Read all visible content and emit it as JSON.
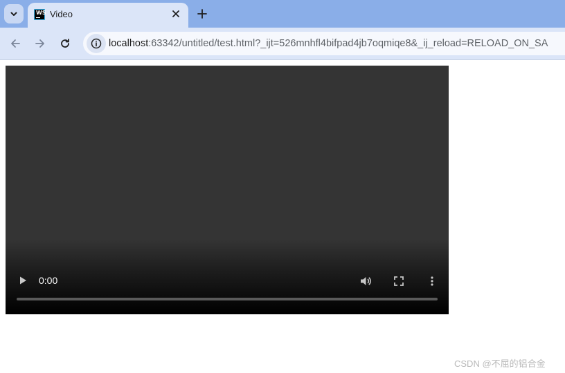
{
  "browser": {
    "tab": {
      "title": "Video",
      "favicon_text": "WS"
    },
    "omnibox": {
      "host": "localhost",
      "rest": ":63342/untitled/test.html?_ijt=526mnhfl4bifpad4jb7oqmiqe8&_ij_reload=RELOAD_ON_SA"
    },
    "icons": {
      "tab_search": "chevron-down-icon",
      "close": "close-icon",
      "new_tab": "plus-icon",
      "back": "arrow-left-icon",
      "forward": "arrow-right-icon",
      "reload": "reload-icon",
      "site_info": "info-icon"
    }
  },
  "video": {
    "current_time": "0:00",
    "progress": 0,
    "icons": {
      "play": "play-icon",
      "volume": "volume-icon",
      "fullscreen": "fullscreen-icon",
      "more": "more-vert-icon"
    }
  },
  "watermark": "CSDN @不屈的铝合金",
  "colors": {
    "tabstrip": "#8aaee8",
    "toolbar": "#dbe5f8",
    "video_bg": "#343434"
  }
}
